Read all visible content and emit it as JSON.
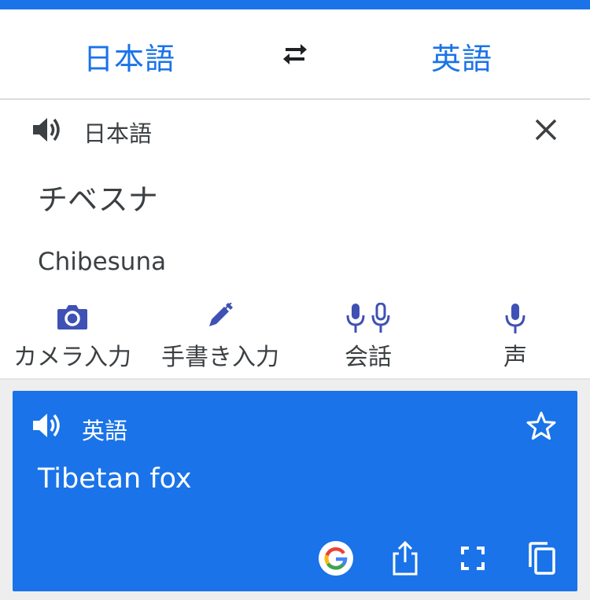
{
  "language_bar": {
    "source_language": "日本語",
    "target_language": "英語"
  },
  "input": {
    "language_label": "日本語",
    "source_text": "チベスナ",
    "transliteration": "Chibesuna"
  },
  "tools": [
    {
      "label": "カメラ入力",
      "icon": "camera-icon"
    },
    {
      "label": "手書き入力",
      "icon": "pen-icon"
    },
    {
      "label": "会話",
      "icon": "conversation-mic-icon"
    },
    {
      "label": "声",
      "icon": "mic-icon"
    }
  ],
  "output": {
    "language_label": "英語",
    "translated_text": "Tibetan fox",
    "actions": [
      "google-icon",
      "share-icon",
      "fullscreen-icon",
      "copy-icon"
    ]
  },
  "colors": {
    "accent": "#1a73e8",
    "tool_icon": "#3f51b5",
    "text": "#3c4043",
    "background_gray": "#eeeeee"
  }
}
